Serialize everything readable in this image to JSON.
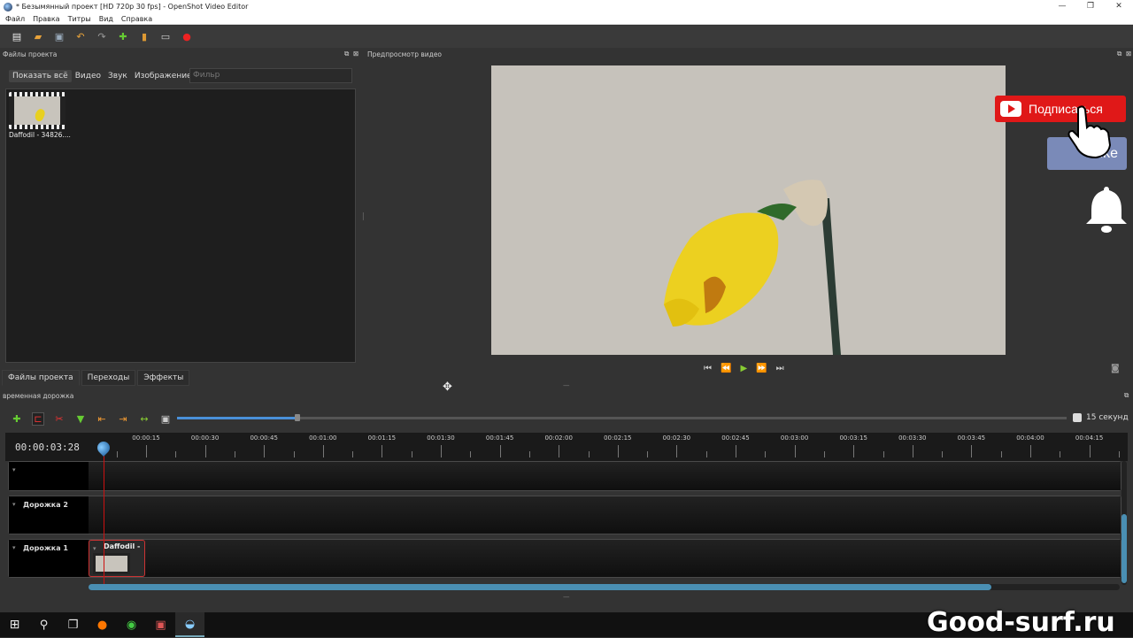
{
  "window": {
    "title": "* Безымянный проект [HD 720p 30 fps] - OpenShot Video Editor",
    "controls": [
      "—",
      "❐",
      "✕"
    ]
  },
  "menu": [
    "Файл",
    "Правка",
    "Титры",
    "Вид",
    "Справка"
  ],
  "files_panel": {
    "header": "Файлы проекта",
    "filters": [
      "Показать всё",
      "Видео",
      "Звук",
      "Изображение"
    ],
    "filter_placeholder": "Фильр",
    "items": [
      {
        "name": "Daffodil - 34826...."
      }
    ]
  },
  "preview_panel": {
    "header": "Предпросмотр видео"
  },
  "bottom_tabs": [
    "Файлы проекта",
    "Переходы",
    "Эффекты"
  ],
  "timeline": {
    "header": "временная дорожка",
    "zoom_label": "15 секунд",
    "zoom_fraction": 0.135,
    "current_time": "00:00:03:28",
    "ticks": [
      "00:00:15",
      "00:00:30",
      "00:00:45",
      "00:01:00",
      "00:01:15",
      "00:01:30",
      "00:01:45",
      "00:02:00",
      "00:02:15",
      "00:02:30",
      "00:02:45",
      "00:03:00",
      "00:03:15",
      "00:03:30",
      "00:03:45",
      "00:04:00",
      "00:04:15"
    ],
    "tracks": [
      {
        "name": ""
      },
      {
        "name": "Дорожка 2"
      },
      {
        "name": "Дорожка 1"
      }
    ],
    "clip": {
      "title": "Daffodil - ..."
    }
  },
  "overlay": {
    "subscribe": "Подписаться",
    "like": "Like"
  },
  "watermark": "Good-surf.ru",
  "colors": {
    "accent": "#4a8fb3",
    "playhead": "#cc1111",
    "subscribe": "#e01818"
  }
}
